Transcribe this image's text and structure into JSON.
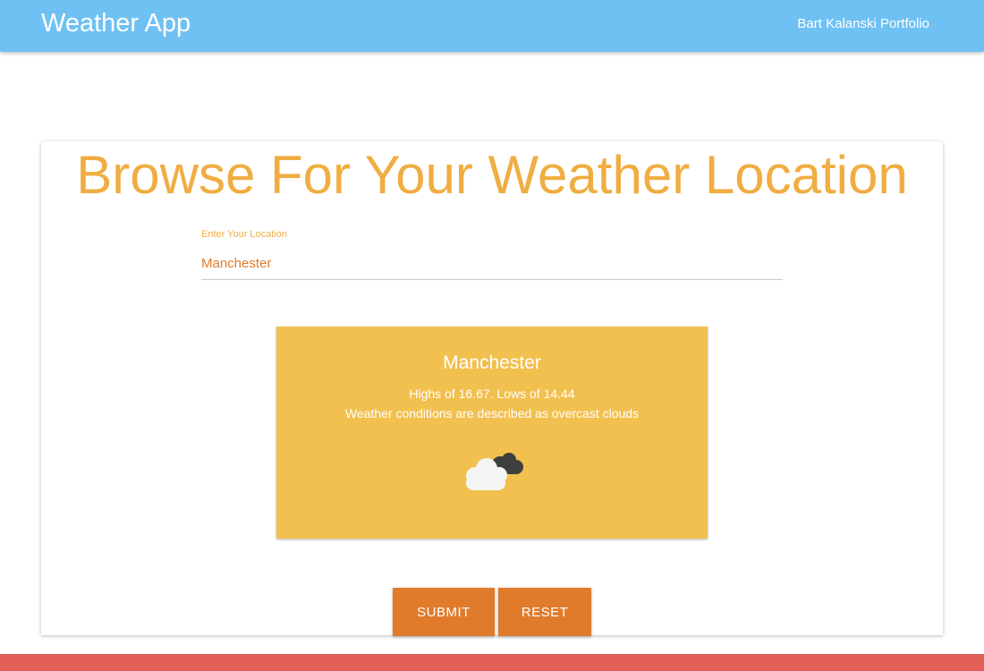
{
  "appbar": {
    "title": "Weather App",
    "portfolio_link": "Bart Kalanski Portfolio"
  },
  "main": {
    "heading": "Browse For Your Weather Location",
    "location_field": {
      "label": "Enter Your Location",
      "value": "Manchester"
    },
    "weather": {
      "city": "Manchester",
      "temps_text": "Highs of 16.67. Lows of 14.44",
      "conditions_text": "Weather conditions are described as overcast clouds",
      "icon": "overcast-clouds-icon"
    },
    "buttons": {
      "submit": "SUBMIT",
      "reset": "RESET"
    }
  },
  "colors": {
    "appbar": "#6fc1f3",
    "heading": "#f0ad41",
    "weather_card": "#f2c04f",
    "button": "#e07b2c",
    "footer": "#e15f55"
  }
}
